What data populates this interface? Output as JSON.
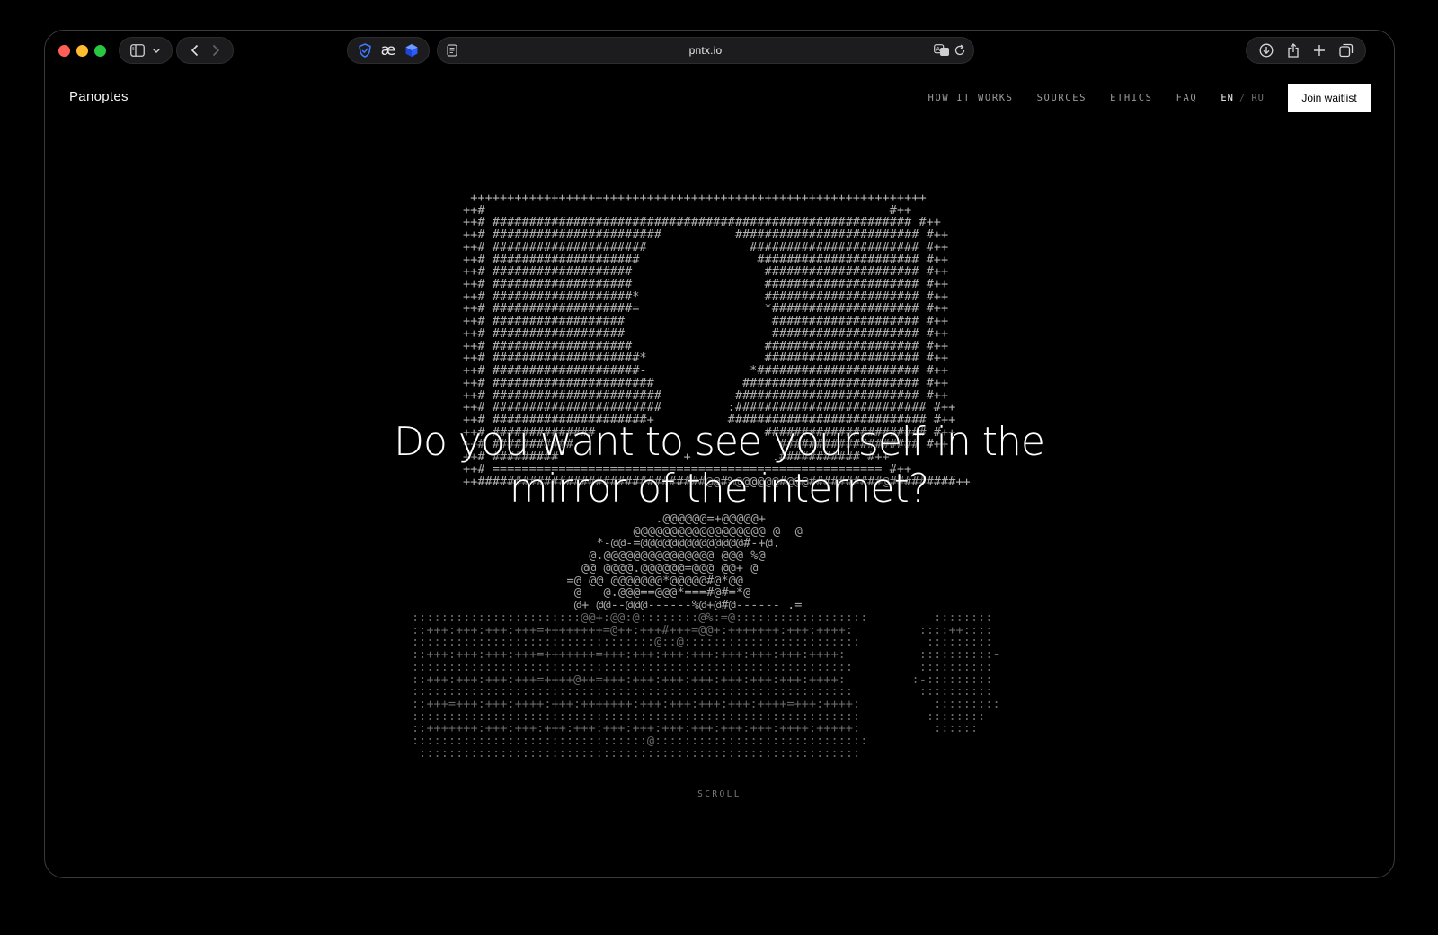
{
  "browser": {
    "url": "pntx.io",
    "icons": {
      "sidebar": "sidebar-icon",
      "chevron": "chevron-down-icon",
      "back": "back-icon",
      "forward": "forward-icon",
      "ext1": "shield-extension-icon",
      "ext2": "ae-extension-icon",
      "ext3": "cube-extension-icon",
      "reader": "reader-icon",
      "translate": "translate-icon",
      "reload": "reload-icon",
      "download": "download-icon",
      "share": "share-icon",
      "new_tab": "plus-icon",
      "tabs": "tabs-overview-icon"
    },
    "ext2_label": "æ"
  },
  "site": {
    "logo": "Panoptes",
    "nav": [
      "HOW IT WORKS",
      "SOURCES",
      "ETHICS",
      "FAQ"
    ],
    "lang": {
      "active": "EN",
      "separator": "/",
      "inactive": "RU"
    },
    "cta": "Join waitlist"
  },
  "hero": {
    "headline_line1": "Do you want to see yourself in the",
    "headline_line2": "mirror of the internet?",
    "scroll_label": "SCROLL"
  },
  "ascii_art": {
    "monitor": [
      "++++++++++++++++++++++++++++++++++++++++++++++++++++++++++++++",
      "++#                                                       #++",
      "++# ######################################################### #++",
      "++# #######################          ######################### #++",
      "++# #####################              ####################### #++",
      "++# ####################                ###################### #++",
      "++# ###################                  ##################### #++",
      "++# ###################                  ##################### #++",
      "++# ###################*                 ##################### #++",
      "++# ###################=                 *#################### #++",
      "++# ##################                    #################### #++",
      "++# ##################                    #################### #++",
      "++# ###################                  ##################### #++",
      "++# ####################*                ##################### #++",
      "++# ####################-              *###################### #++",
      "++# ######################            ######################## #++",
      "++# #######################          ######################### #++",
      "++# #######################         :########################## #++",
      "++# #####################+          ########################### #++",
      "++# ##############                       ###################### #++",
      "++# ###########                            ################### #++",
      "++# #########                 +           .########### #++",
      "++# ===================================================== #++",
      "++###############################@@#%@@@@@@#@@@##########@#########++"
    ],
    "figure": [
      ".@@@@@@=+@@@@@+",
      "@@@@@@@@@@@@@@@@@@ @  @",
      "*-@@-=@@@@@@@@@@@@@@#-+@.",
      "@.@@@@@@@@@@@@@@@ @@@ %@",
      "@@ @@@@.@@@@@@=@@@ @@+ @",
      "=@ @@ @@@@@@@*@@@@@#@*@@",
      "@   @.@@@==@@@*===#@#=*@",
      "@+ @@--@@@------%@+@#@------ .="
    ],
    "desk": [
      ":::::::::::::::::::::::@@+:@@:@::::::::@%:=@::::::::::::::::::         ::::::::",
      "::+++:+++:+++:+++=++++++++=@++:+++#+++=@@+:+++++++:+++:++++:         ::::++::::",
      ":::::::::::::::::::::::::::::::::@::@::::::::::::::::::::::::         :::::::::",
      "::+++:+++:+++:+++=+++++++=+++:+++:+++:+++:+++:+++:+++:++++:          ::::::::::-",
      "::::::::::::::::::::::::::::::::::::::::::::::::::::::::::::         ::::::::::",
      "::+++:+++:+++:+++=++++@++=+++:+++:+++:+++:+++:+++:+++:++++:         :-:::::::::",
      "::::::::::::::::::::::::::::::::::::::::::::::::::::::::::::         ::::::::::",
      "::+++=+++:+++:++++:+++:+++++++:+++:+++:+++:+++:++++=+++:++++:          :::::::::",
      ":::::::::::::::::::::::::::::::::::::::::::::::::::::::::::::         ::::::::",
      "::+++++++:+++:+++:+++:+++:+++:+++:+++:+++:+++:+++:++++:+++++:          ::::::",
      "::::::::::::::::::::::::::::::::@:::::::::::::::::::::::::::::",
      " ::::::::::::::::::::::::::::::::::::::::::::::::::::::::::::"
    ]
  }
}
